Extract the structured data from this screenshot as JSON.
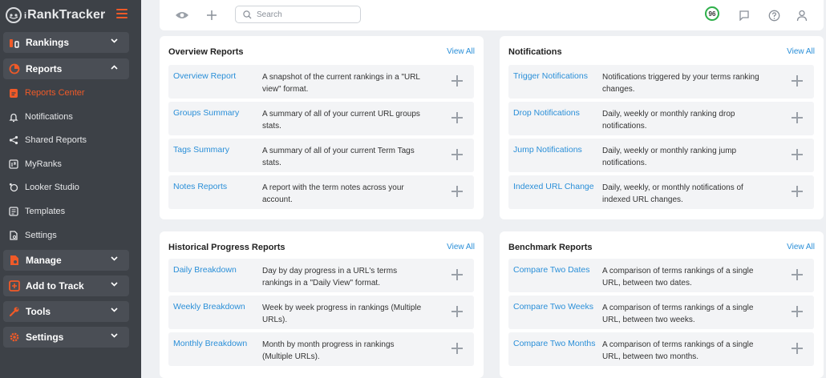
{
  "app": {
    "logo_text": "RankTracker",
    "logo_prefix": "i"
  },
  "sidebar": {
    "groups": [
      {
        "label": "Rankings",
        "icon": "rankings-icon",
        "expanded": false
      },
      {
        "label": "Reports",
        "icon": "reports-icon",
        "expanded": true
      },
      {
        "label": "Manage",
        "icon": "manage-icon",
        "expanded": false
      },
      {
        "label": "Add to Track",
        "icon": "add-to-track-icon",
        "expanded": false
      },
      {
        "label": "Tools",
        "icon": "tools-icon",
        "expanded": false
      },
      {
        "label": "Settings",
        "icon": "settings-icon",
        "expanded": false
      }
    ],
    "report_items": [
      {
        "label": "Reports Center",
        "icon": "reports-center-icon",
        "active": true
      },
      {
        "label": "Notifications",
        "icon": "bell-icon",
        "active": false
      },
      {
        "label": "Shared Reports",
        "icon": "share-icon",
        "active": false
      },
      {
        "label": "MyRanks",
        "icon": "myranks-icon",
        "active": false
      },
      {
        "label": "Looker Studio",
        "icon": "looker-studio-icon",
        "active": false
      },
      {
        "label": "Templates",
        "icon": "templates-icon",
        "active": false
      },
      {
        "label": "Settings",
        "icon": "report-settings-icon",
        "active": false
      }
    ]
  },
  "topbar": {
    "search_placeholder": "Search",
    "score": "96"
  },
  "colors": {
    "accent": "#f05a28",
    "link": "#2a8fd8",
    "score_ring": "#2eaf4a",
    "sidebar_bg": "#3d4147"
  },
  "cards": {
    "overview": {
      "title": "Overview Reports",
      "view_all": "View All",
      "rows": [
        {
          "name": "Overview Report",
          "desc": "A snapshot of the current rankings in a \"URL view\" format."
        },
        {
          "name": "Groups Summary",
          "desc": "A summary of all of your current URL groups stats."
        },
        {
          "name": "Tags Summary",
          "desc": "A summary of all of your current Term Tags stats."
        },
        {
          "name": "Notes Reports",
          "desc": "A report with the term notes across your account."
        }
      ]
    },
    "notifications": {
      "title": "Notifications",
      "view_all": "View All",
      "rows": [
        {
          "name": "Trigger Notifications",
          "desc": "Notifications triggered by your terms ranking changes."
        },
        {
          "name": "Drop Notifications",
          "desc": "Daily, weekly or monthly ranking drop notifications."
        },
        {
          "name": "Jump Notifications",
          "desc": "Daily, weekly or monthly ranking jump notifications."
        },
        {
          "name": "Indexed URL Change",
          "desc": "Daily, weekly, or monthly notifications of indexed URL changes."
        }
      ]
    },
    "historical": {
      "title": "Historical Progress Reports",
      "view_all": "View All",
      "rows": [
        {
          "name": "Daily Breakdown",
          "desc": "Day by day progress in a URL's terms rankings in a \"Daily View\" format."
        },
        {
          "name": "Weekly Breakdown",
          "desc": "Week by week progress in rankings (Multiple URLs)."
        },
        {
          "name": "Monthly Breakdown",
          "desc": "Month by month progress in rankings (Multiple URLs)."
        }
      ]
    },
    "benchmark": {
      "title": "Benchmark Reports",
      "view_all": "View All",
      "rows": [
        {
          "name": "Compare Two Dates",
          "desc": "A comparison of terms rankings of a single URL, between two dates."
        },
        {
          "name": "Compare Two Weeks",
          "desc": "A comparison of terms rankings of a single URL, between two weeks."
        },
        {
          "name": "Compare Two Months",
          "desc": "A comparison of terms rankings of a single URL, between two months."
        }
      ]
    }
  }
}
